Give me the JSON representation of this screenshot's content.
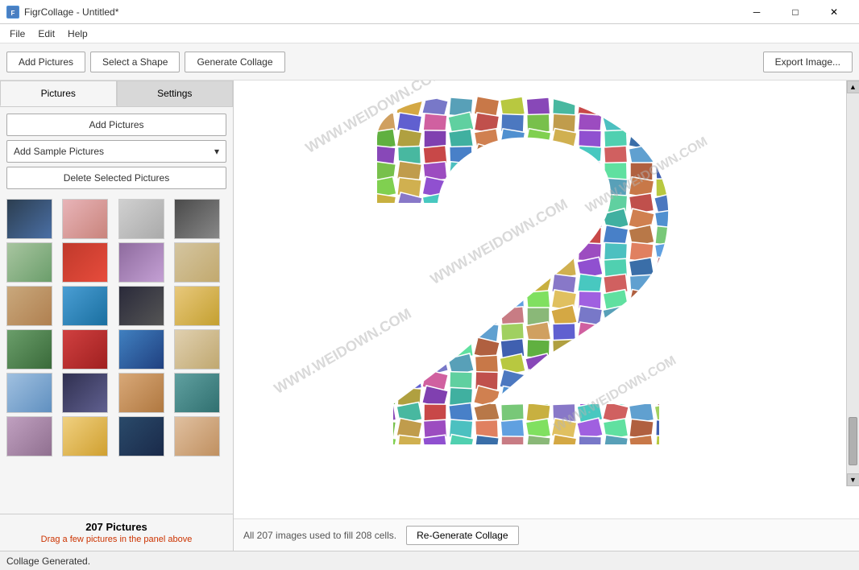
{
  "app": {
    "title": "FigrCollage - Untitled*",
    "icon_label": "FC"
  },
  "titlebar": {
    "minimize_label": "─",
    "maximize_label": "□",
    "close_label": "✕"
  },
  "menubar": {
    "items": [
      {
        "id": "file",
        "label": "File"
      },
      {
        "id": "edit",
        "label": "Edit"
      },
      {
        "id": "help",
        "label": "Help"
      }
    ]
  },
  "toolbar": {
    "add_pictures_label": "Add Pictures",
    "select_shape_label": "Select a Shape",
    "generate_collage_label": "Generate Collage",
    "export_image_label": "Export Image..."
  },
  "left_panel": {
    "tab_pictures_label": "Pictures",
    "tab_settings_label": "Settings",
    "add_pictures_btn": "Add Pictures",
    "add_sample_pictures_btn": "Add Sample Pictures",
    "delete_selected_btn": "Delete Selected Pictures",
    "picture_count": "207 Pictures",
    "picture_hint": "Drag a few pictures in the panel above",
    "dropdown_arrow": "▾"
  },
  "canvas": {
    "status_text": "All 207 images used to fill 208 cells.",
    "regen_label": "Re-Generate Collage",
    "watermarks": [
      "WWW.WEIDOWN.COM",
      "WWW.WEIDOWN.COM",
      "WWW.WEIDOWN.COM"
    ]
  },
  "statusbar": {
    "text": "Collage Generated."
  },
  "thumbnails": [
    0,
    1,
    2,
    3,
    4,
    5,
    6,
    7,
    8,
    9,
    10,
    11,
    12,
    13,
    14,
    15,
    16,
    17,
    18,
    19,
    20,
    21,
    22,
    23
  ]
}
